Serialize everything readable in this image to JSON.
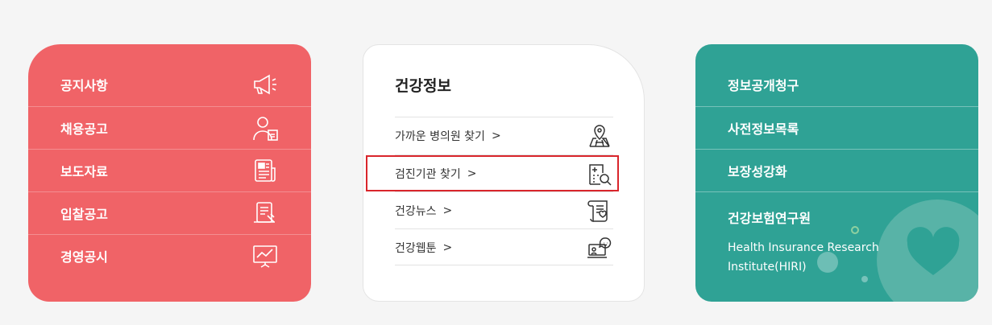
{
  "red_card": {
    "items": [
      {
        "label": "공지사항",
        "icon": "megaphone-icon"
      },
      {
        "label": "채용공고",
        "icon": "recruiter-icon"
      },
      {
        "label": "보도자료",
        "icon": "newspaper-icon"
      },
      {
        "label": "입찰공고",
        "icon": "bid-document-icon"
      },
      {
        "label": "경영공시",
        "icon": "presentation-chart-icon"
      }
    ]
  },
  "health_card": {
    "title": "건강정보",
    "items": [
      {
        "label": "가까운 병의원 찾기",
        "chevron": ">",
        "icon": "map-pin-icon"
      },
      {
        "label": "검진기관 찾기",
        "chevron": ">",
        "icon": "hospital-search-icon"
      },
      {
        "label": "건강뉴스",
        "chevron": ">",
        "icon": "news-scroll-icon"
      },
      {
        "label": "건강웹툰",
        "chevron": ">",
        "icon": "webtoon-laptop-icon"
      }
    ]
  },
  "teal_card": {
    "items": [
      {
        "label": "정보공개청구"
      },
      {
        "label": "사전정보목록"
      },
      {
        "label": "보장성강화"
      }
    ],
    "hiri_title": "건강보험연구원",
    "hiri_subtitle": "Health Insurance Research Institute(HIRI)"
  }
}
